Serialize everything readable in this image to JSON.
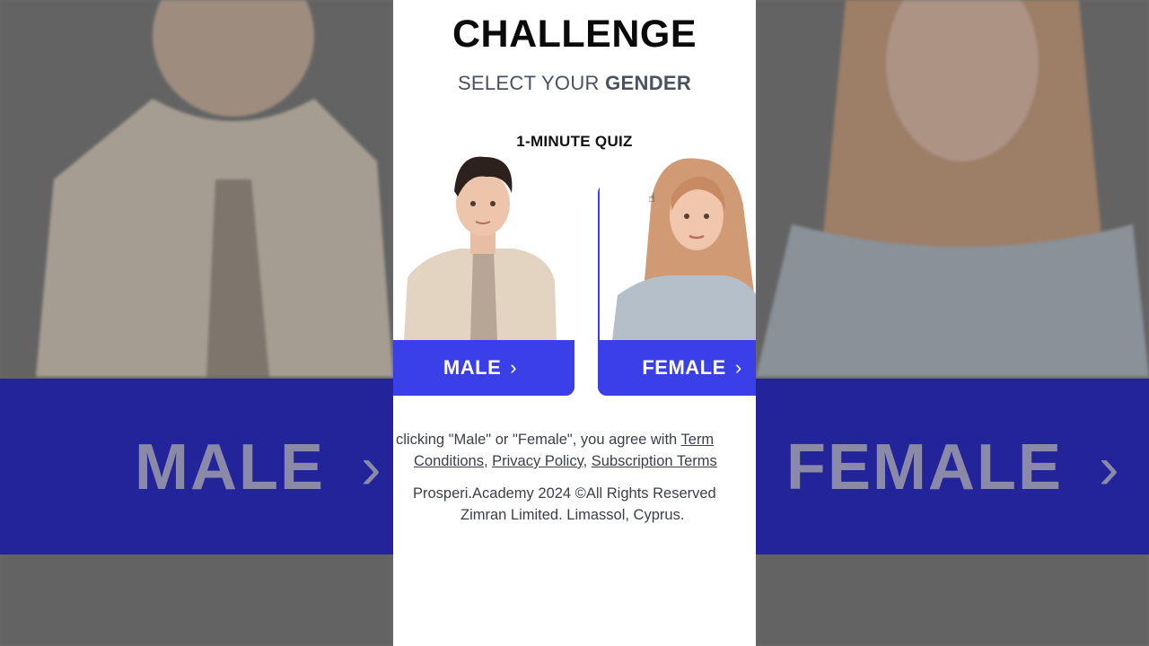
{
  "page": {
    "title": "CHALLENGE",
    "subtitle_prefix": "SELECT YOUR ",
    "subtitle_emphasis": "GENDER",
    "quiz_label": "1-MINUTE QUIZ"
  },
  "options": [
    {
      "label": "MALE",
      "icon": "chevron-right-icon"
    },
    {
      "label": "FEMALE",
      "icon": "chevron-right-icon"
    }
  ],
  "background": {
    "left_label": "MALE",
    "right_label": "FEMALE"
  },
  "legal": {
    "prefix": "clicking \"Male\" or \"Female\", you agree with ",
    "terms_partial": "Term",
    "conditions_partial": "Conditions",
    "separator1": ", ",
    "privacy": "Privacy Policy",
    "separator2": ", ",
    "subscription": "Subscription Terms"
  },
  "footer": {
    "line1": "Prosperi.Academy 2024 ©All Rights Reserved",
    "line2": "Zimran Limited. Limassol, Cyprus."
  },
  "colors": {
    "accent": "#3b3fe8",
    "band": "#23239a",
    "title": "#0a0a0a"
  }
}
